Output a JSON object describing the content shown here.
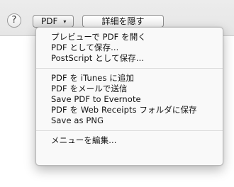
{
  "toolbar": {
    "help_label": "?",
    "pdf_label": "PDF",
    "pdf_chevron": "▾",
    "details_label": "詳細を隠す"
  },
  "menu": {
    "group1": [
      "プレビューで PDF を開く",
      "PDF として保存...",
      "PostScript として保存..."
    ],
    "group2": [
      "PDF を iTunes に追加",
      "PDF をメールで送信",
      "Save PDF to Evernote",
      "PDF を Web Receipts フォルダに保存",
      "Save as PNG"
    ],
    "group3": [
      "メニューを編集..."
    ]
  }
}
